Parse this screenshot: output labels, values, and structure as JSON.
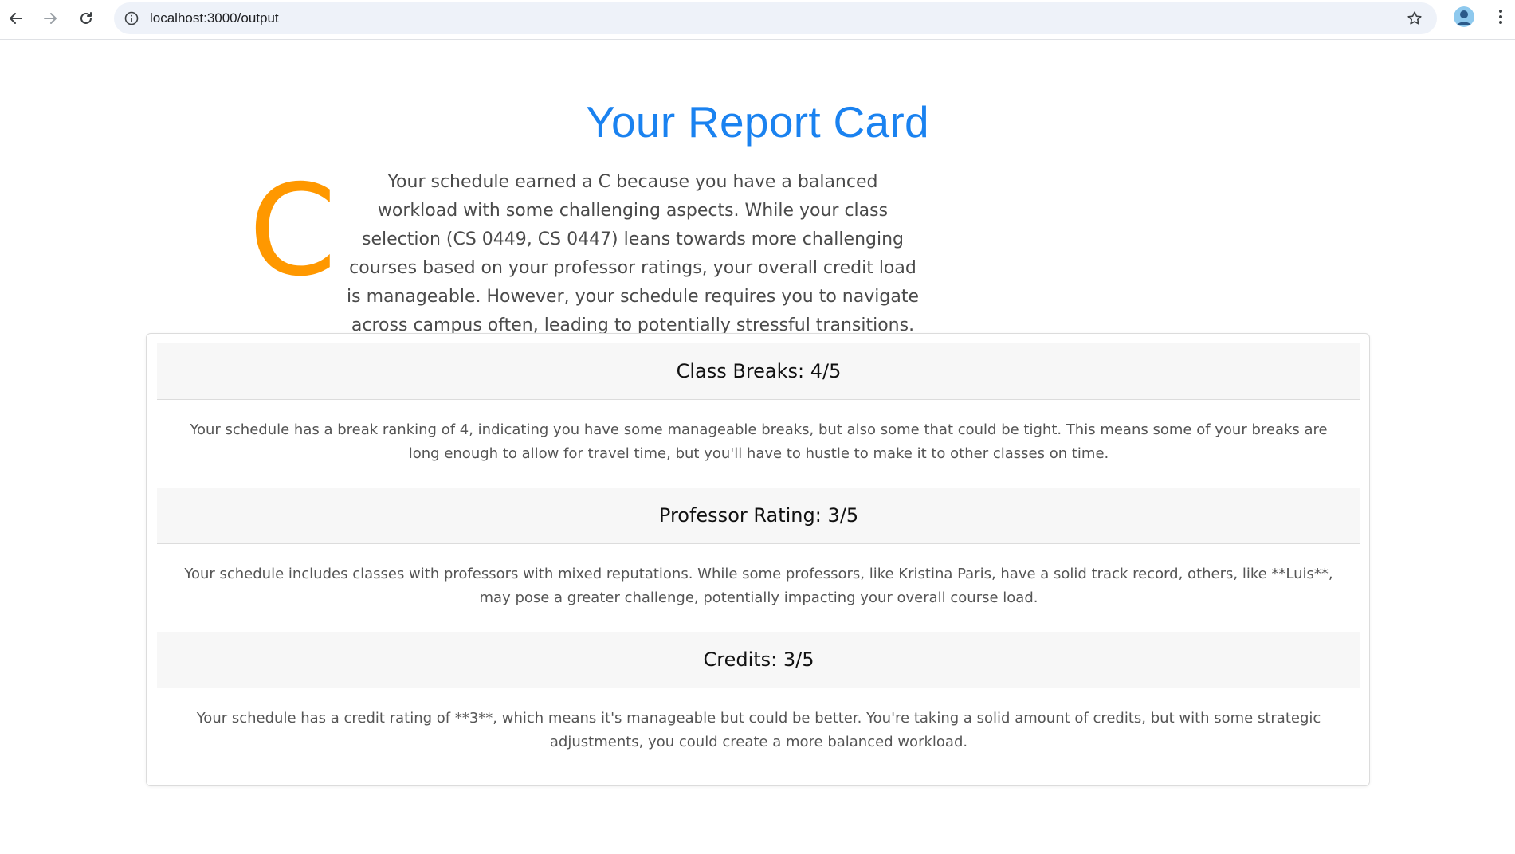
{
  "browser": {
    "url": "localhost:3000/output",
    "icons": {
      "back": "arrow-left-icon",
      "forward": "arrow-right-icon",
      "reload": "reload-icon",
      "site_info": "info-icon",
      "bookmark": "star-icon",
      "profile": "avatar",
      "menu": "kebab-menu-icon"
    }
  },
  "report": {
    "title": "Your Report Card",
    "grade": "C",
    "grade_color": "#ff9800",
    "title_color": "#1a82f0",
    "summary": "Your schedule earned a C because you have a balanced workload with some challenging aspects. While your class selection (CS 0449, CS 0447) leans towards more challenging courses based on your professor ratings, your overall credit load is manageable. However, your schedule requires you to navigate across campus often, leading to potentially stressful transitions."
  },
  "sections": [
    {
      "heading": "Class Breaks: 4/5",
      "body": "Your schedule has a break ranking of 4, indicating you have some manageable breaks, but also some that could be tight. This means some of your breaks are long enough to allow for travel time, but you'll have to hustle to make it to other classes on time."
    },
    {
      "heading": "Professor Rating: 3/5",
      "body": "Your schedule includes classes with professors with mixed reputations. While some professors, like Kristina Paris, have a solid track record, others, like **Luis**, may pose a greater challenge, potentially impacting your overall course load."
    },
    {
      "heading": "Credits: 3/5",
      "body": "Your schedule has a credit rating of **3**, which means it's manageable but could be better. You're taking a solid amount of credits, but with some strategic adjustments, you could create a more balanced workload."
    }
  ]
}
